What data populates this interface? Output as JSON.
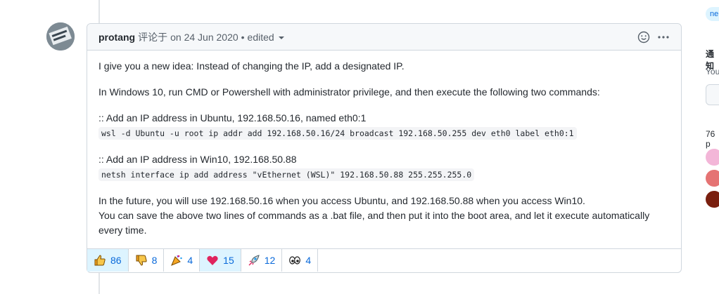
{
  "comment": {
    "author": "protang",
    "action": "评论于",
    "date": "on 24 Jun 2020",
    "separator": "•",
    "edited": "edited",
    "body": {
      "p1": "I give you a new idea: Instead of changing the IP, add a designated IP.",
      "p2": "In Windows 10, run CMD or Powershell with administrator privilege, and then execute the following two commands:",
      "p3_text": ":: Add an IP address in Ubuntu, 192.168.50.16, named eth0:1",
      "p3_code": "wsl -d Ubuntu -u root ip addr add 192.168.50.16/24 broadcast 192.168.50.255 dev eth0 label eth0:1",
      "p4_text": ":: Add an IP address in Win10, 192.168.50.88",
      "p4_code": "netsh interface ip add address \"vEthernet (WSL)\" 192.168.50.88 255.255.255.0",
      "p5_line1": "In the future, you will use 192.168.50.16 when you access Ubuntu, and 192.168.50.88 when you access Win10.",
      "p5_line2": "You can save the above two lines of commands as a .bat file, and then put it into the boot area, and let it execute automatically every time."
    },
    "reactions": [
      {
        "name": "thumbs-up",
        "count": "86"
      },
      {
        "name": "thumbs-down",
        "count": "8"
      },
      {
        "name": "party",
        "count": "4"
      },
      {
        "name": "heart",
        "count": "15"
      },
      {
        "name": "rocket",
        "count": "12"
      },
      {
        "name": "eyes",
        "count": "4"
      }
    ]
  },
  "sidebar": {
    "badge": "ne",
    "title": "通知",
    "subtitle": "You",
    "participants": "76 p"
  }
}
